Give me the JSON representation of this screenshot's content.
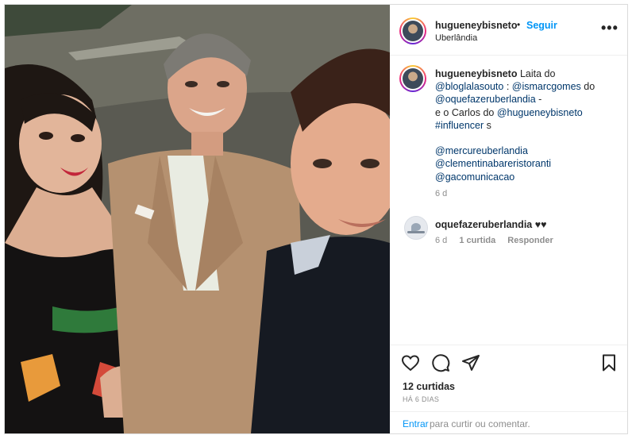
{
  "post": {
    "username": "hugueneybisneto",
    "dot": "•",
    "follow_label": "Seguir",
    "location": "Uberlândia",
    "more_label": "•••"
  },
  "caption": {
    "username": "hugueneybisneto",
    "line1": " Laita do",
    "m1": "@bloglalasouto",
    "sep1": " : ",
    "m2": "@ismarcgomes",
    "do2": " do",
    "m3": "@oquefazeruberlandia",
    "dash": " -",
    "line4a": "e o Carlos do ",
    "m4": "@hugueneybisneto",
    "tag": "#influencer",
    "tag_suffix": " s",
    "m5": "@mercureuberlandia",
    "m6": "@clementinabareristoranti",
    "m7": "@gacomunicacao",
    "time": "6 d"
  },
  "comment": {
    "username": "oquefazeruberlandia",
    "text": " ♥♥",
    "time": "6 d",
    "likes": "1 curtida",
    "reply": "Responder"
  },
  "actions": {
    "like": "heart-icon",
    "comment": "comment-icon",
    "share": "share-icon",
    "save": "bookmark-icon"
  },
  "likes_count": "12 curtidas",
  "posted_ago": "HÁ 6 DIAS",
  "comment_bar": {
    "login": "Entrar",
    "rest": "para curtir ou comentar."
  }
}
